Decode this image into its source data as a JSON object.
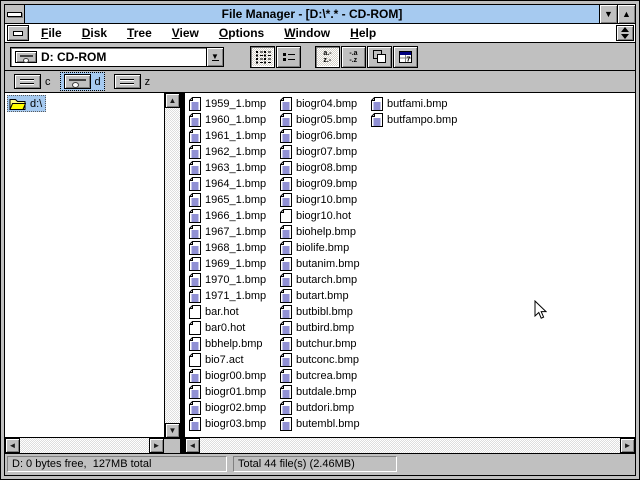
{
  "window": {
    "title": "File Manager - [D:\\*.* - CD-ROM]"
  },
  "icons": {
    "minimize": "▼",
    "maximize": "▲",
    "dropdown": "▼",
    "scroll_up": "▲",
    "scroll_down": "▼",
    "scroll_left": "◄",
    "scroll_right": "►"
  },
  "menu_bar": {
    "items": [
      {
        "label": "File"
      },
      {
        "label": "Disk"
      },
      {
        "label": "Tree"
      },
      {
        "label": "View"
      },
      {
        "label": "Options"
      },
      {
        "label": "Window"
      },
      {
        "label": "Help"
      }
    ]
  },
  "toolbar": {
    "drive_selector": {
      "value": "D: CD-ROM",
      "icon": "cdrom-drive-icon"
    },
    "buttons": [
      {
        "name": "view-by-name",
        "pressed": true
      },
      {
        "name": "view-all-file-details",
        "pressed": false
      },
      {
        "name": "sort-by-name",
        "pressed": true,
        "glyph_top": "a.-",
        "glyph_bottom": "z.-"
      },
      {
        "name": "sort-by-type",
        "pressed": false,
        "glyph_top": "-.a",
        "glyph_bottom": "-.z"
      },
      {
        "name": "copy",
        "pressed": false
      },
      {
        "name": "schedule",
        "pressed": false,
        "glyph": "7"
      }
    ]
  },
  "drive_bar": {
    "drives": [
      {
        "letter": "c",
        "type": "hard-drive-icon",
        "selected": false
      },
      {
        "letter": "d",
        "type": "cdrom-drive-icon",
        "selected": true
      },
      {
        "letter": "z",
        "type": "hard-drive-icon",
        "selected": false
      }
    ]
  },
  "tree_panel": {
    "items": [
      {
        "label": "d:\\",
        "icon": "open-folder-icon",
        "selected": true
      }
    ]
  },
  "file_panel": {
    "columns": [
      [
        {
          "name": "1959_1.bmp",
          "icon": "document-icon"
        },
        {
          "name": "1960_1.bmp",
          "icon": "document-icon"
        },
        {
          "name": "1961_1.bmp",
          "icon": "document-icon"
        },
        {
          "name": "1962_1.bmp",
          "icon": "document-icon"
        },
        {
          "name": "1963_1.bmp",
          "icon": "document-icon"
        },
        {
          "name": "1964_1.bmp",
          "icon": "document-icon"
        },
        {
          "name": "1965_1.bmp",
          "icon": "document-icon"
        },
        {
          "name": "1966_1.bmp",
          "icon": "document-icon"
        },
        {
          "name": "1967_1.bmp",
          "icon": "document-icon"
        },
        {
          "name": "1968_1.bmp",
          "icon": "document-icon"
        },
        {
          "name": "1969_1.bmp",
          "icon": "document-icon"
        },
        {
          "name": "1970_1.bmp",
          "icon": "document-icon"
        },
        {
          "name": "1971_1.bmp",
          "icon": "document-icon"
        },
        {
          "name": "bar.hot",
          "icon": "blank-document-icon"
        },
        {
          "name": "bar0.hot",
          "icon": "blank-document-icon"
        },
        {
          "name": "bbhelp.bmp",
          "icon": "document-icon"
        },
        {
          "name": "bio7.act",
          "icon": "blank-document-icon"
        },
        {
          "name": "biogr00.bmp",
          "icon": "document-icon"
        },
        {
          "name": "biogr01.bmp",
          "icon": "document-icon"
        },
        {
          "name": "biogr02.bmp",
          "icon": "document-icon"
        },
        {
          "name": "biogr03.bmp",
          "icon": "document-icon"
        }
      ],
      [
        {
          "name": "biogr04.bmp",
          "icon": "document-icon"
        },
        {
          "name": "biogr05.bmp",
          "icon": "document-icon"
        },
        {
          "name": "biogr06.bmp",
          "icon": "document-icon"
        },
        {
          "name": "biogr07.bmp",
          "icon": "document-icon"
        },
        {
          "name": "biogr08.bmp",
          "icon": "document-icon"
        },
        {
          "name": "biogr09.bmp",
          "icon": "document-icon"
        },
        {
          "name": "biogr10.bmp",
          "icon": "document-icon"
        },
        {
          "name": "biogr10.hot",
          "icon": "blank-document-icon"
        },
        {
          "name": "biohelp.bmp",
          "icon": "document-icon"
        },
        {
          "name": "biolife.bmp",
          "icon": "document-icon"
        },
        {
          "name": "butanim.bmp",
          "icon": "document-icon"
        },
        {
          "name": "butarch.bmp",
          "icon": "document-icon"
        },
        {
          "name": "butart.bmp",
          "icon": "document-icon"
        },
        {
          "name": "butbibl.bmp",
          "icon": "document-icon"
        },
        {
          "name": "butbird.bmp",
          "icon": "document-icon"
        },
        {
          "name": "butchur.bmp",
          "icon": "document-icon"
        },
        {
          "name": "butconc.bmp",
          "icon": "document-icon"
        },
        {
          "name": "butcrea.bmp",
          "icon": "document-icon"
        },
        {
          "name": "butdale.bmp",
          "icon": "document-icon"
        },
        {
          "name": "butdori.bmp",
          "icon": "document-icon"
        },
        {
          "name": "butembl.bmp",
          "icon": "document-icon"
        }
      ],
      [
        {
          "name": "butfami.bmp",
          "icon": "document-icon"
        },
        {
          "name": "butfampo.bmp",
          "icon": "document-icon"
        }
      ]
    ]
  },
  "status_bar": {
    "left": "D: 0 bytes free,  127MB total",
    "right": "Total 44 file(s) (2.46MB)"
  },
  "colors": {
    "title_bar": "#a6caf0",
    "selection": "#a6caf0",
    "window_gray": "#c0c0c0",
    "shadow_gray": "#808080",
    "doc_line_blue": "#2222aa"
  }
}
